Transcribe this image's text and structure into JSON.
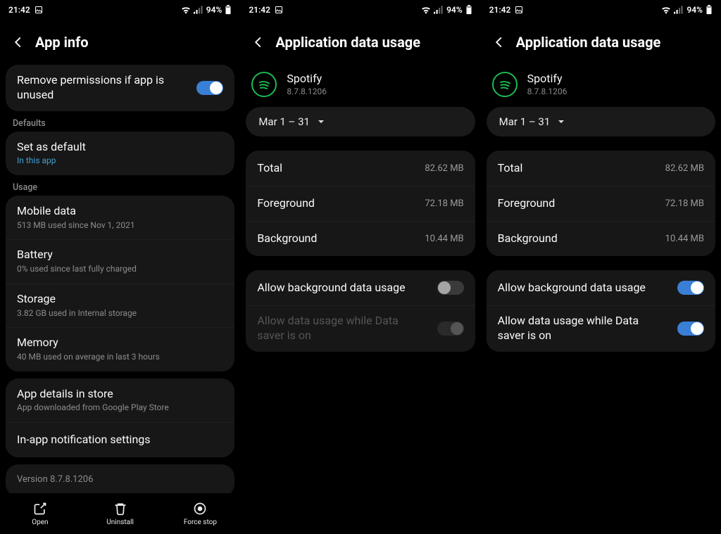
{
  "status": {
    "time": "21:42",
    "battery": "94%"
  },
  "pane1": {
    "title": "App info",
    "remove_permissions": "Remove permissions if app is unused",
    "defaults_label": "Defaults",
    "set_default": "Set as default",
    "set_default_sub": "In this app",
    "usage_label": "Usage",
    "mobile_data": "Mobile data",
    "mobile_data_sub": "513 MB used since Nov 1, 2021",
    "battery": "Battery",
    "battery_sub": "0% used since last fully charged",
    "storage": "Storage",
    "storage_sub": "3.82 GB used in Internal storage",
    "memory": "Memory",
    "memory_sub": "40 MB used on average in last 3 hours",
    "app_details": "App details in store",
    "app_details_sub": "App downloaded from Google Play Store",
    "inapp_notif": "In-app notification settings",
    "version": "Version 8.7.8.1206",
    "actions": {
      "open": "Open",
      "uninstall": "Uninstall",
      "force_stop": "Force stop"
    }
  },
  "pane2": {
    "title": "Application data usage",
    "app_name": "Spotify",
    "app_version": "8.7.8.1206",
    "date_range": "Mar 1 – 31",
    "total_label": "Total",
    "total_val": "82.62 MB",
    "fg_label": "Foreground",
    "fg_val": "72.18 MB",
    "bg_label": "Background",
    "bg_val": "10.44 MB",
    "allow_bg": "Allow background data usage",
    "allow_saver": "Allow data usage while Data saver is on"
  },
  "pane3": {
    "title": "Application data usage",
    "app_name": "Spotify",
    "app_version": "8.7.8.1206",
    "date_range": "Mar 1 – 31",
    "total_label": "Total",
    "total_val": "82.62 MB",
    "fg_label": "Foreground",
    "fg_val": "72.18 MB",
    "bg_label": "Background",
    "bg_val": "10.44 MB",
    "allow_bg": "Allow background data usage",
    "allow_saver": "Allow data usage while Data saver is on"
  }
}
